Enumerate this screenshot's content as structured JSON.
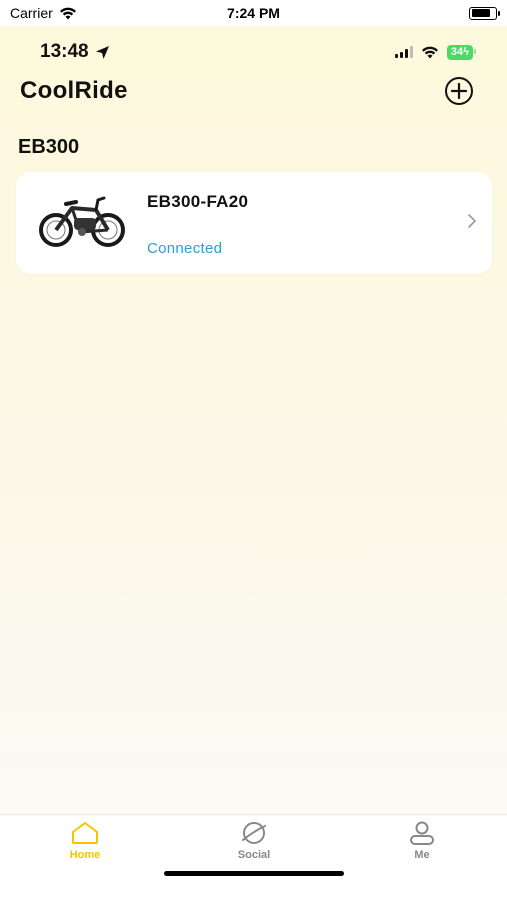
{
  "sim_status": {
    "carrier": "Carrier",
    "time": "7:24 PM"
  },
  "device_status": {
    "time": "13:48",
    "battery": "34"
  },
  "header": {
    "title": "CoolRide",
    "add_icon": "plus-circle-icon"
  },
  "section": {
    "title": "EB300"
  },
  "devices": [
    {
      "name": "EB300-FA20",
      "status": "Connected",
      "image": "ebike-icon"
    }
  ],
  "tabs": [
    {
      "label": "Home",
      "icon": "home-icon",
      "active": true
    },
    {
      "label": "Social",
      "icon": "planet-icon",
      "active": false
    },
    {
      "label": "Me",
      "icon": "person-icon",
      "active": false
    }
  ],
  "colors": {
    "accent": "#f2c500",
    "connected": "#2a9fd8",
    "battery": "#4cd964",
    "background_top": "#fdf9dc"
  }
}
